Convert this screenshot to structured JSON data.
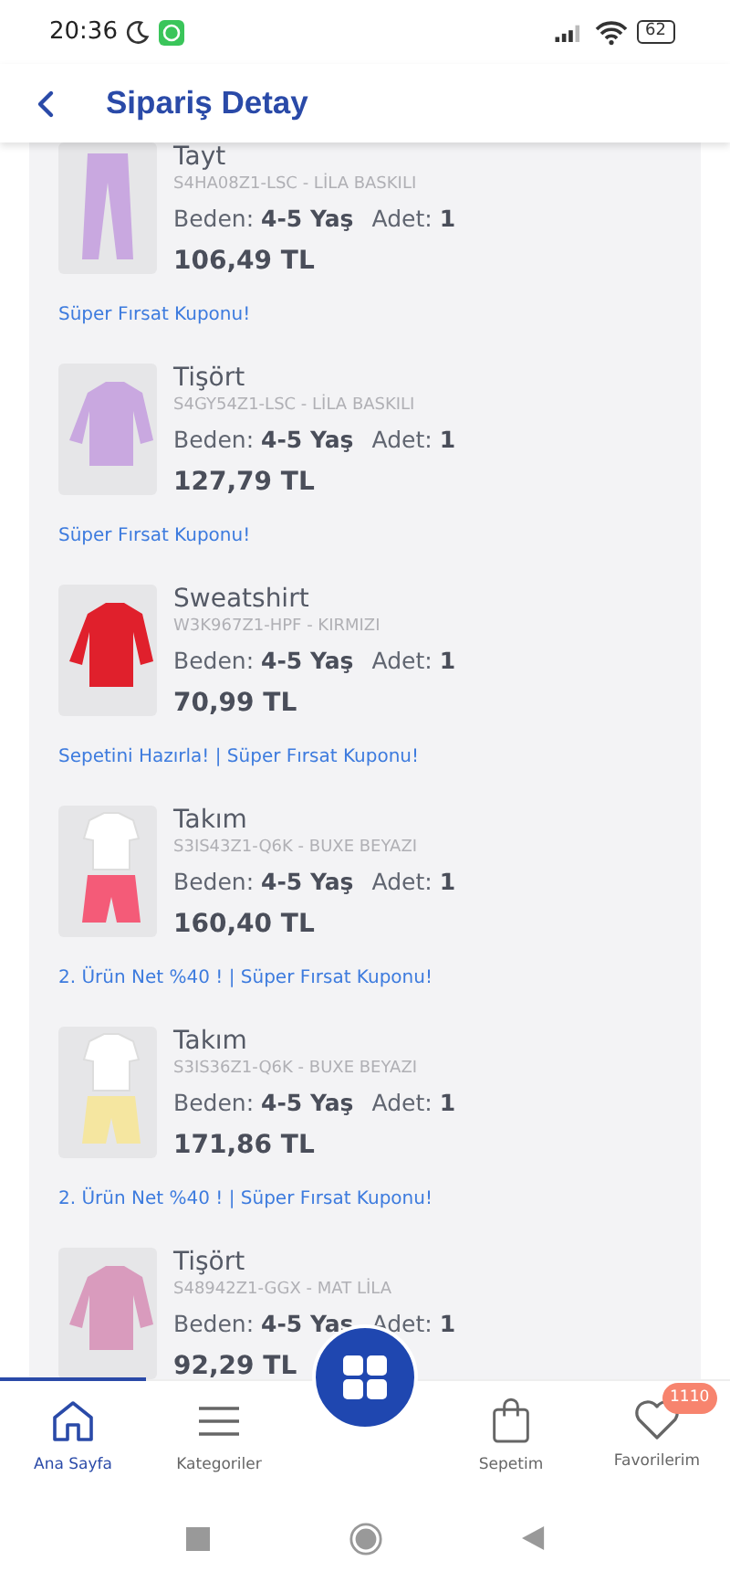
{
  "status_bar": {
    "time": "20:36",
    "battery": "62"
  },
  "header": {
    "title": "Sipariş Detay"
  },
  "items": [
    {
      "name": "Tayt",
      "code": "S4HA08Z1-LSC - LİLA BASKILI",
      "size_label": "Beden:",
      "size": "4-5 Yaş",
      "qty_label": "Adet:",
      "qty": "1",
      "price": "106,49 TL",
      "kind": "pants",
      "color": "#c9a8e0",
      "coupon": "Süper Fırsat Kuponu!"
    },
    {
      "name": "Tişört",
      "code": "S4GY54Z1-LSC - LİLA BASKILI",
      "size_label": "Beden:",
      "size": "4-5 Yaş",
      "qty_label": "Adet:",
      "qty": "1",
      "price": "127,79 TL",
      "kind": "top",
      "color": "#c9a8e0",
      "coupon": "Süper Fırsat Kuponu!"
    },
    {
      "name": "Sweatshirt",
      "code": "W3K967Z1-HPF - KIRMIZI",
      "size_label": "Beden:",
      "size": "4-5 Yaş",
      "qty_label": "Adet:",
      "qty": "1",
      "price": "70,99 TL",
      "kind": "top",
      "color": "#e0202c",
      "coupon": "Sepetini Hazırla! | Süper Fırsat Kuponu!"
    },
    {
      "name": "Takım",
      "code": "S3IS43Z1-Q6K - BUXE BEYAZI",
      "size_label": "Beden:",
      "size": "4-5 Yaş",
      "qty_label": "Adet:",
      "qty": "1",
      "price": "160,40 TL",
      "kind": "set",
      "color": "#f45b78",
      "coupon": "2. Ürün Net %40 ! | Süper Fırsat Kuponu!"
    },
    {
      "name": "Takım",
      "code": "S3IS36Z1-Q6K - BUXE BEYAZI",
      "size_label": "Beden:",
      "size": "4-5 Yaş",
      "qty_label": "Adet:",
      "qty": "1",
      "price": "171,86 TL",
      "kind": "set",
      "color": "#f5e6a0",
      "coupon": "2. Ürün Net %40 ! | Süper Fırsat Kuponu!"
    },
    {
      "name": "Tişört",
      "code": "S48942Z1-GGX - MAT LİLA",
      "size_label": "Beden:",
      "size": "4-5 Yaş",
      "qty_label": "Adet:",
      "qty": "1",
      "price": "92,29 TL",
      "kind": "top",
      "color": "#d99bbd"
    }
  ],
  "bottom_nav": [
    {
      "kind": "home",
      "label": "Ana Sayfa",
      "selected": true
    },
    {
      "kind": "menu",
      "label": "Kategoriler",
      "selected": false
    },
    {
      "kind": "grid",
      "selected": false
    },
    {
      "kind": "bag",
      "label": "Sepetim",
      "selected": false
    },
    {
      "kind": "heart",
      "label": "Favorilerim",
      "selected": false,
      "badge": "1110"
    }
  ]
}
